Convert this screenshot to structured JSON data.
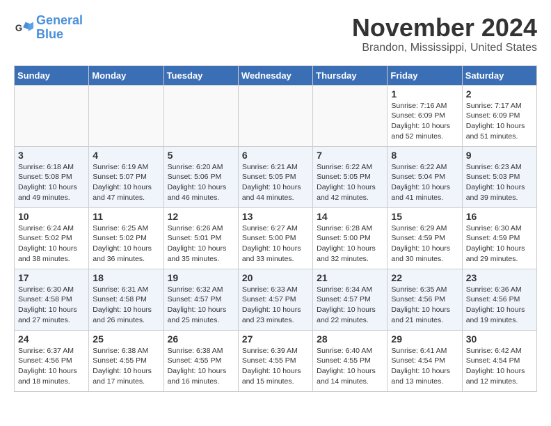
{
  "logo": {
    "line1": "General",
    "line2": "Blue"
  },
  "title": "November 2024",
  "location": "Brandon, Mississippi, United States",
  "days_of_week": [
    "Sunday",
    "Monday",
    "Tuesday",
    "Wednesday",
    "Thursday",
    "Friday",
    "Saturday"
  ],
  "weeks": [
    [
      {
        "day": "",
        "info": ""
      },
      {
        "day": "",
        "info": ""
      },
      {
        "day": "",
        "info": ""
      },
      {
        "day": "",
        "info": ""
      },
      {
        "day": "",
        "info": ""
      },
      {
        "day": "1",
        "info": "Sunrise: 7:16 AM\nSunset: 6:09 PM\nDaylight: 10 hours\nand 52 minutes."
      },
      {
        "day": "2",
        "info": "Sunrise: 7:17 AM\nSunset: 6:09 PM\nDaylight: 10 hours\nand 51 minutes."
      }
    ],
    [
      {
        "day": "3",
        "info": "Sunrise: 6:18 AM\nSunset: 5:08 PM\nDaylight: 10 hours\nand 49 minutes."
      },
      {
        "day": "4",
        "info": "Sunrise: 6:19 AM\nSunset: 5:07 PM\nDaylight: 10 hours\nand 47 minutes."
      },
      {
        "day": "5",
        "info": "Sunrise: 6:20 AM\nSunset: 5:06 PM\nDaylight: 10 hours\nand 46 minutes."
      },
      {
        "day": "6",
        "info": "Sunrise: 6:21 AM\nSunset: 5:05 PM\nDaylight: 10 hours\nand 44 minutes."
      },
      {
        "day": "7",
        "info": "Sunrise: 6:22 AM\nSunset: 5:05 PM\nDaylight: 10 hours\nand 42 minutes."
      },
      {
        "day": "8",
        "info": "Sunrise: 6:22 AM\nSunset: 5:04 PM\nDaylight: 10 hours\nand 41 minutes."
      },
      {
        "day": "9",
        "info": "Sunrise: 6:23 AM\nSunset: 5:03 PM\nDaylight: 10 hours\nand 39 minutes."
      }
    ],
    [
      {
        "day": "10",
        "info": "Sunrise: 6:24 AM\nSunset: 5:02 PM\nDaylight: 10 hours\nand 38 minutes."
      },
      {
        "day": "11",
        "info": "Sunrise: 6:25 AM\nSunset: 5:02 PM\nDaylight: 10 hours\nand 36 minutes."
      },
      {
        "day": "12",
        "info": "Sunrise: 6:26 AM\nSunset: 5:01 PM\nDaylight: 10 hours\nand 35 minutes."
      },
      {
        "day": "13",
        "info": "Sunrise: 6:27 AM\nSunset: 5:00 PM\nDaylight: 10 hours\nand 33 minutes."
      },
      {
        "day": "14",
        "info": "Sunrise: 6:28 AM\nSunset: 5:00 PM\nDaylight: 10 hours\nand 32 minutes."
      },
      {
        "day": "15",
        "info": "Sunrise: 6:29 AM\nSunset: 4:59 PM\nDaylight: 10 hours\nand 30 minutes."
      },
      {
        "day": "16",
        "info": "Sunrise: 6:30 AM\nSunset: 4:59 PM\nDaylight: 10 hours\nand 29 minutes."
      }
    ],
    [
      {
        "day": "17",
        "info": "Sunrise: 6:30 AM\nSunset: 4:58 PM\nDaylight: 10 hours\nand 27 minutes."
      },
      {
        "day": "18",
        "info": "Sunrise: 6:31 AM\nSunset: 4:58 PM\nDaylight: 10 hours\nand 26 minutes."
      },
      {
        "day": "19",
        "info": "Sunrise: 6:32 AM\nSunset: 4:57 PM\nDaylight: 10 hours\nand 25 minutes."
      },
      {
        "day": "20",
        "info": "Sunrise: 6:33 AM\nSunset: 4:57 PM\nDaylight: 10 hours\nand 23 minutes."
      },
      {
        "day": "21",
        "info": "Sunrise: 6:34 AM\nSunset: 4:57 PM\nDaylight: 10 hours\nand 22 minutes."
      },
      {
        "day": "22",
        "info": "Sunrise: 6:35 AM\nSunset: 4:56 PM\nDaylight: 10 hours\nand 21 minutes."
      },
      {
        "day": "23",
        "info": "Sunrise: 6:36 AM\nSunset: 4:56 PM\nDaylight: 10 hours\nand 19 minutes."
      }
    ],
    [
      {
        "day": "24",
        "info": "Sunrise: 6:37 AM\nSunset: 4:56 PM\nDaylight: 10 hours\nand 18 minutes."
      },
      {
        "day": "25",
        "info": "Sunrise: 6:38 AM\nSunset: 4:55 PM\nDaylight: 10 hours\nand 17 minutes."
      },
      {
        "day": "26",
        "info": "Sunrise: 6:38 AM\nSunset: 4:55 PM\nDaylight: 10 hours\nand 16 minutes."
      },
      {
        "day": "27",
        "info": "Sunrise: 6:39 AM\nSunset: 4:55 PM\nDaylight: 10 hours\nand 15 minutes."
      },
      {
        "day": "28",
        "info": "Sunrise: 6:40 AM\nSunset: 4:55 PM\nDaylight: 10 hours\nand 14 minutes."
      },
      {
        "day": "29",
        "info": "Sunrise: 6:41 AM\nSunset: 4:54 PM\nDaylight: 10 hours\nand 13 minutes."
      },
      {
        "day": "30",
        "info": "Sunrise: 6:42 AM\nSunset: 4:54 PM\nDaylight: 10 hours\nand 12 minutes."
      }
    ]
  ]
}
